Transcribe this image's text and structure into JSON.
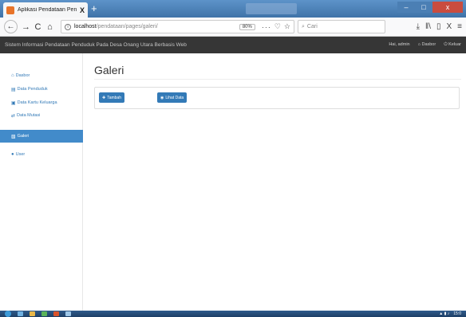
{
  "browser": {
    "tab_title": "Aplikasi Pendataan Penduduk",
    "tab_close": "X",
    "newtab": "+",
    "win_min": "‒",
    "win_max": "□",
    "win_close": "x",
    "back": "←",
    "forward": "→",
    "reload": "C",
    "home": "⌂",
    "url_info": "i",
    "url_host": "localhost",
    "url_path": "/pendataan/pages/galeri/",
    "zoom": "80%",
    "more": "···",
    "pocket": "♡",
    "bookmark": "☆",
    "search_placeholder": "Cari",
    "search_glyph": "⌕",
    "download": "⤓",
    "library": "‖\\",
    "reader": "▯",
    "extension": "X",
    "menu": "≡"
  },
  "appbar": {
    "title": "Sistem Informasi Pendataan Penduduk Pada Desa Onang Utara Berbasis Web",
    "greeting": "Hai, admin",
    "dashboard": "Dasbor",
    "logout": "Keluar"
  },
  "sidebar": {
    "items": [
      {
        "label": "Dasbor",
        "icon": "⌂"
      },
      {
        "label": "Data Penduduk",
        "icon": "▤"
      },
      {
        "label": "Data Kartu Keluarga",
        "icon": "▣"
      },
      {
        "label": "Data Mutasi",
        "icon": "⇄"
      },
      {
        "label": "Galeri",
        "icon": "▧"
      },
      {
        "label": "User",
        "icon": "●"
      }
    ]
  },
  "main": {
    "title": "Galeri",
    "add_button": "Tambah",
    "view_button": "Lihat Data",
    "add_icon": "✚",
    "view_icon": "◉"
  },
  "taskbar": {
    "clock": "15:0",
    "tray_icons": "▲ ▮ ♪"
  },
  "colors": {
    "primary": "#337ab7",
    "active": "#428bca",
    "appbar": "#363636"
  }
}
